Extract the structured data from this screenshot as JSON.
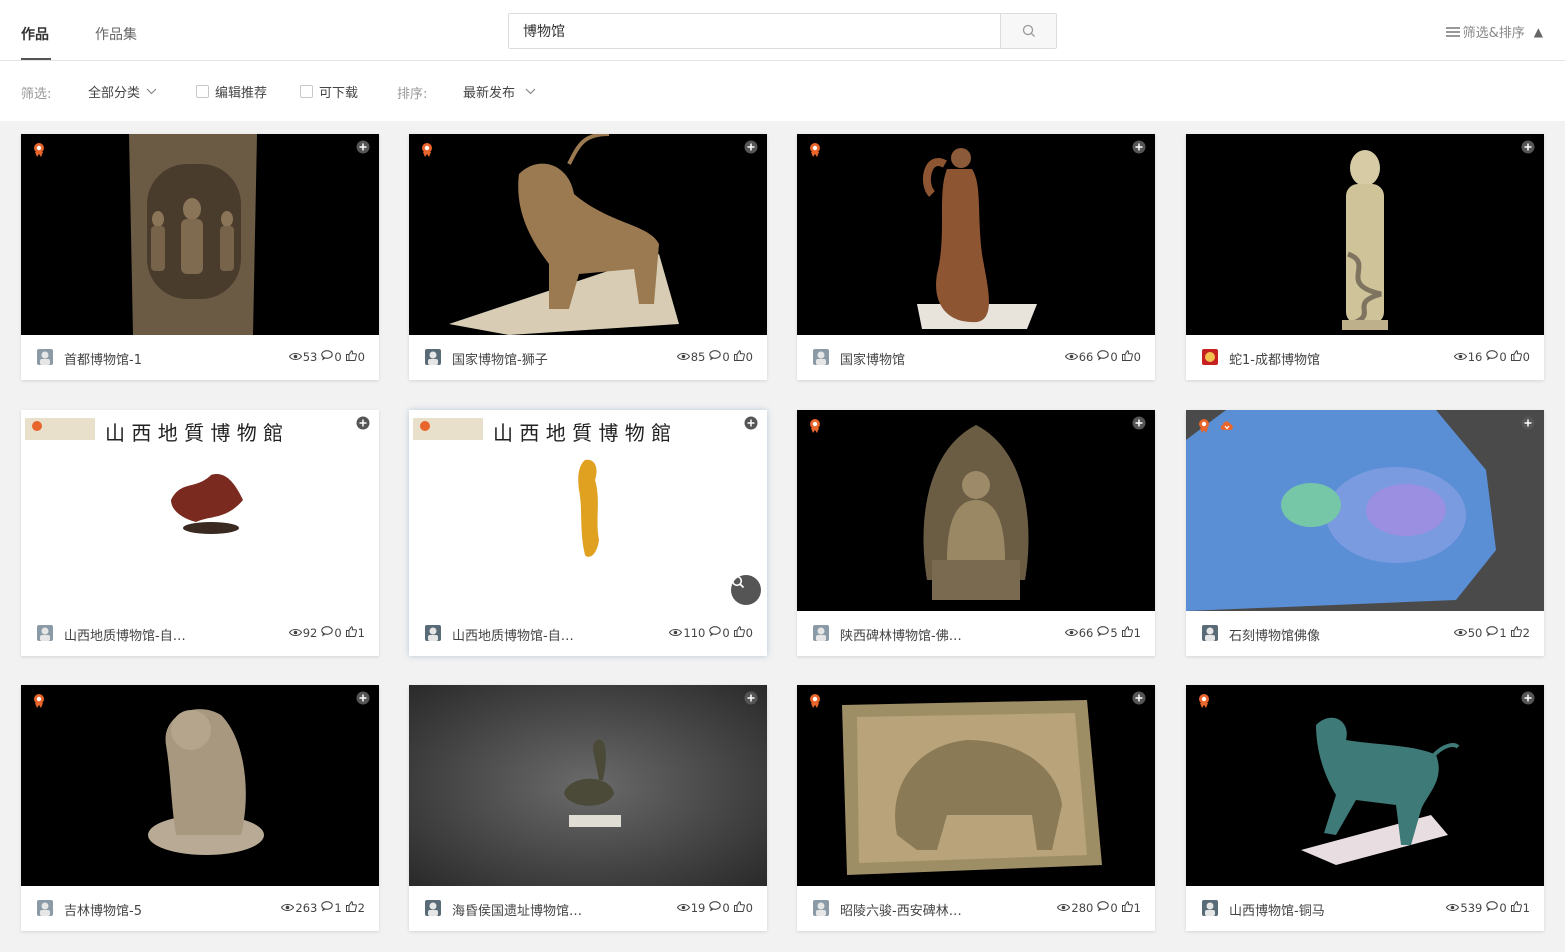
{
  "tabs": [
    {
      "label": "作品",
      "active": true
    },
    {
      "label": "作品集",
      "active": false
    }
  ],
  "search": {
    "value": "博物馆"
  },
  "filter_toggle": {
    "label": "筛选&排序",
    "caret": "▲"
  },
  "filters": {
    "filter_label": "筛选:",
    "category": "全部分类",
    "editor_pick": "编辑推荐",
    "downloadable": "可下载",
    "sort_label": "排序:",
    "sort_value": "最新发布"
  },
  "colors": {
    "accent_orange": "#e8652b",
    "header_bg": "#ffffff",
    "page_bg": "#f2f2f2"
  },
  "cards": [
    {
      "title": "首都博物馆-1",
      "views": "53",
      "comments": "0",
      "likes": "0",
      "badges": [
        "award-icon"
      ],
      "scene": "stele"
    },
    {
      "title": "国家博物馆-狮子",
      "views": "85",
      "comments": "0",
      "likes": "0",
      "badges": [
        "award-icon"
      ],
      "scene": "beast"
    },
    {
      "title": "国家博物馆",
      "views": "66",
      "comments": "0",
      "likes": "0",
      "badges": [
        "award-icon"
      ],
      "scene": "dancer"
    },
    {
      "title": "蛇1-成都博物馆",
      "views": "16",
      "comments": "0",
      "likes": "0",
      "badges": [],
      "scene": "statue"
    },
    {
      "title": "山西地质博物馆-自…",
      "views": "92",
      "comments": "0",
      "likes": "1",
      "badges": [],
      "scene": "museum-coral",
      "banner": "山西地質博物館"
    },
    {
      "title": "山西地质博物馆-自…",
      "views": "110",
      "comments": "0",
      "likes": "0",
      "badges": [],
      "scene": "museum-gold",
      "banner": "山西地質博物館",
      "zoom": true
    },
    {
      "title": "陕西碑林博物馆-佛…",
      "views": "66",
      "comments": "5",
      "likes": "1",
      "badges": [
        "award-icon"
      ],
      "scene": "buddha"
    },
    {
      "title": "石刻博物馆佛像",
      "views": "50",
      "comments": "1",
      "likes": "2",
      "badges": [
        "award-icon",
        "download-cloud-icon"
      ],
      "scene": "normalmap"
    },
    {
      "title": "吉林博物馆-5",
      "views": "263",
      "comments": "1",
      "likes": "2",
      "badges": [
        "award-icon"
      ],
      "scene": "lion"
    },
    {
      "title": "海昏侯国遗址博物馆…",
      "views": "19",
      "comments": "0",
      "likes": "0",
      "badges": [],
      "scene": "bird"
    },
    {
      "title": "昭陵六骏-西安碑林…",
      "views": "280",
      "comments": "0",
      "likes": "1",
      "badges": [
        "award-icon"
      ],
      "scene": "relief"
    },
    {
      "title": "山西博物馆-铜马",
      "views": "539",
      "comments": "0",
      "likes": "1",
      "badges": [
        "award-icon"
      ],
      "scene": "horse"
    }
  ]
}
